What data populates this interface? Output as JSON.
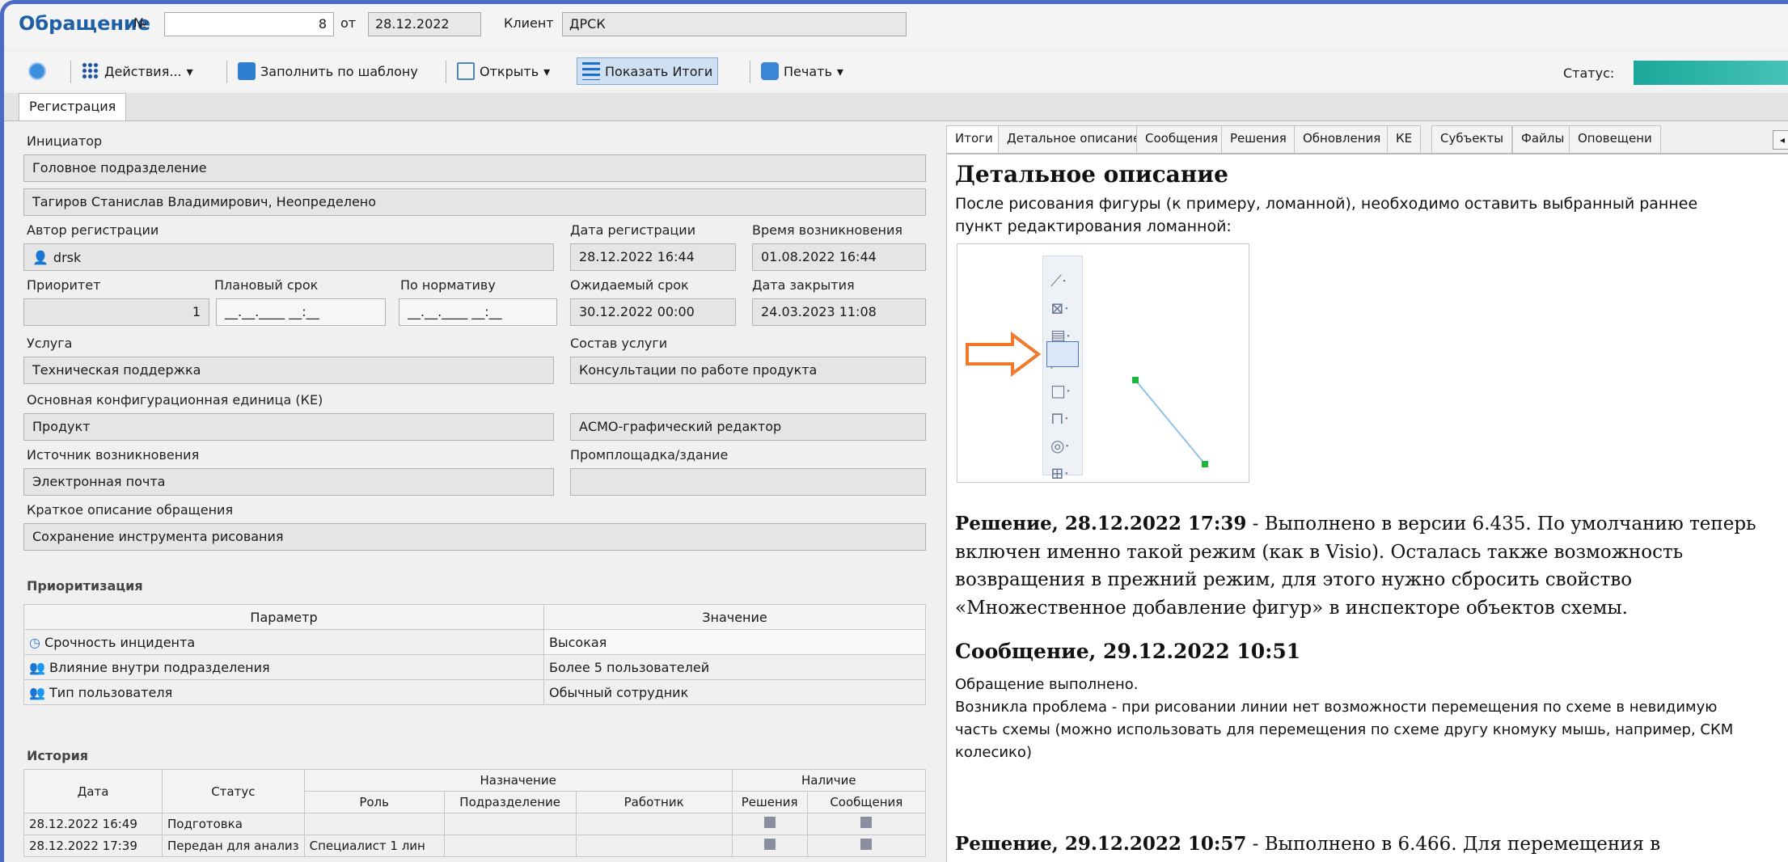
{
  "header": {
    "title": "Обращение",
    "number_label": "№",
    "number_value": "8",
    "date_label": "от",
    "date_value": "28.12.2022",
    "client_label": "Клиент",
    "client_value": "ДРСК",
    "status_label": "Статус:"
  },
  "toolbar": {
    "actions": "Действия...",
    "fill_template": "Заполнить по шаблону",
    "open": "Открыть",
    "show_totals": "Показать Итоги",
    "print": "Печать"
  },
  "tabs": [
    "Регистрация"
  ],
  "form": {
    "initiator_label": "Инициатор",
    "initiator_dept": "Головное подразделение",
    "initiator_person": "Тагиров Станислав Владимирович, Неопределено",
    "author_label": "Автор регистрации",
    "author_value": "drsk",
    "reg_date_label": "Дата регистрации",
    "reg_date": "28.12.2022 16:44",
    "occur_label": "Время возникновения",
    "occur_value": "01.08.2022 16:44",
    "priority_label": "Приоритет",
    "priority_value": "1",
    "planned_label": "Плановый срок",
    "planned_value": "__.__.____ __:__",
    "norm_label": "По нормативу",
    "norm_value": "__.__.____ __:__",
    "expected_label": "Ожидаемый срок",
    "expected_value": "30.12.2022 00:00",
    "close_label": "Дата закрытия",
    "close_value": "24.03.2023 11:08",
    "service_label": "Услуга",
    "service_value": "Техническая поддержка",
    "service_comp_label": "Состав услуги",
    "service_comp_value": "Консультации по работе продукта",
    "ke_label": "Основная конфигурационная единица (КЕ)",
    "ke_value": "Продукт",
    "ke_value2": "АСМО-графический редактор",
    "source_label": "Источник возникновения",
    "source_value": "Электронная почта",
    "site_label": "Промплощадка/здание",
    "short_label": "Краткое описание обращения",
    "short_value": "Сохранение инструмента рисования"
  },
  "prioritization": {
    "title": "Приоритизация",
    "col_param": "Параметр",
    "col_value": "Значение",
    "rows": [
      {
        "param": "Срочность инцидента",
        "value": "Высокая"
      },
      {
        "param": "Влияние внутри подразделения",
        "value": "Более 5 пользователей"
      },
      {
        "param": "Тип пользователя",
        "value": "Обычный сотрудник"
      }
    ]
  },
  "history": {
    "title": "История",
    "col_date": "Дата",
    "col_status": "Статус",
    "col_assign": "Назначение",
    "col_role": "Роль",
    "col_dept": "Подразделение",
    "col_worker": "Работник",
    "col_presence": "Наличие",
    "col_solutions": "Решения",
    "col_messages": "Сообщения",
    "rows": [
      {
        "date": "28.12.2022 16:49",
        "status": "Подготовка",
        "role": ""
      },
      {
        "date": "28.12.2022 17:39",
        "status": "Передан для анализ",
        "role": "Специалист 1 лин"
      }
    ]
  },
  "right_tabs": [
    "Итоги",
    "Детальное описание",
    "Сообщения",
    "Решения",
    "Обновления",
    "КЕ",
    "Субъекты",
    "Файлы",
    "Оповещени"
  ],
  "details": {
    "heading": "Детальное описание",
    "text": "После рисования фигуры (к примеру, ломанной), необходимо оставить выбранный раннее пункт редактирования ломанной:",
    "sol1_head": "Решение, 28.12.2022 17:39",
    "sol1_text": " - Выполнено в версии 6.435. По умолчанию теперь включен именно такой режим (как в Visio). Осталась также возможность возвращения в прежний режим, для этого нужно сбросить свойство «Множественное добавление фигур» в инспекторе объектов схемы.",
    "msg_head": "Сообщение, 29.12.2022 10:51",
    "msg_line1": "Обращение выполнено.",
    "msg_line2": "Возникла проблема - при рисовании линии нет возможности перемещения по схеме в невидимую часть схемы (можно использовать для перемещения по схеме другу кномуку мышь, например, СКМ колесико)",
    "sol2_head": "Решение, 29.12.2022 10:57",
    "sol2_text": " - Выполнено в 6.466. Для перемещения в"
  },
  "colors": {
    "title": "#1f5fa8",
    "accent": "#4a6cc8",
    "active_button": "#cfe0f3",
    "arrow": "#f07a2a"
  }
}
